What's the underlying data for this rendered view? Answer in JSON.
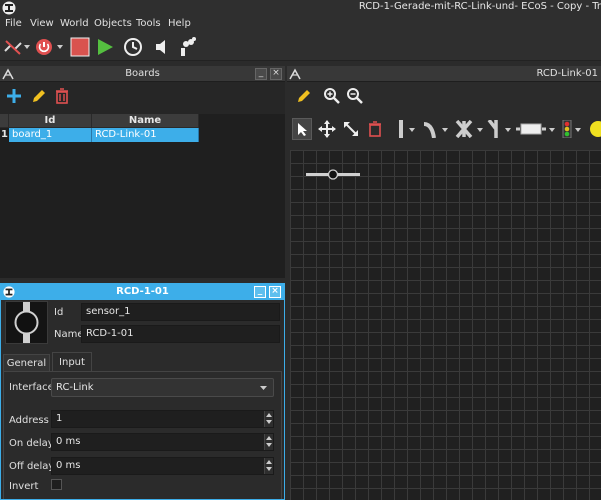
{
  "window": {
    "title": "RCD-1-Gerade-mit-RC-Link-und- ECoS - Copy - Tr"
  },
  "menu": [
    "File",
    "View",
    "World",
    "Objects",
    "Tools",
    "Help"
  ],
  "toolbar": {
    "icons": [
      "connection-icon",
      "power-icon",
      "stop-icon",
      "run-icon",
      "clock-icon",
      "mute-icon",
      "smoke-icon"
    ],
    "colors": {
      "power": "#e05050",
      "stop": "#d9534f",
      "run": "#55c040"
    }
  },
  "boards_panel": {
    "title": "Boards",
    "columns": [
      "Id",
      "Name"
    ],
    "rows": [
      {
        "num": "1",
        "id": "board_1",
        "name": "RCD-Link-01"
      }
    ]
  },
  "canvas": {
    "title": "RCD-Link-01"
  },
  "sensor_window": {
    "title": "RCD-1-01",
    "id_label": "Id",
    "id_value": "sensor_1",
    "name_label": "Name",
    "name_value": "RCD-1-01",
    "tabs": [
      "General",
      "Input"
    ],
    "interface_label": "Interface",
    "interface_value": "RC-Link",
    "address_label": "Address",
    "address_value": "1",
    "on_delay_label": "On delay",
    "on_delay_value": "0 ms",
    "off_delay_label": "Off delay",
    "off_delay_value": "0 ms",
    "invert_label": "Invert"
  },
  "accent_color": "#3daee9"
}
